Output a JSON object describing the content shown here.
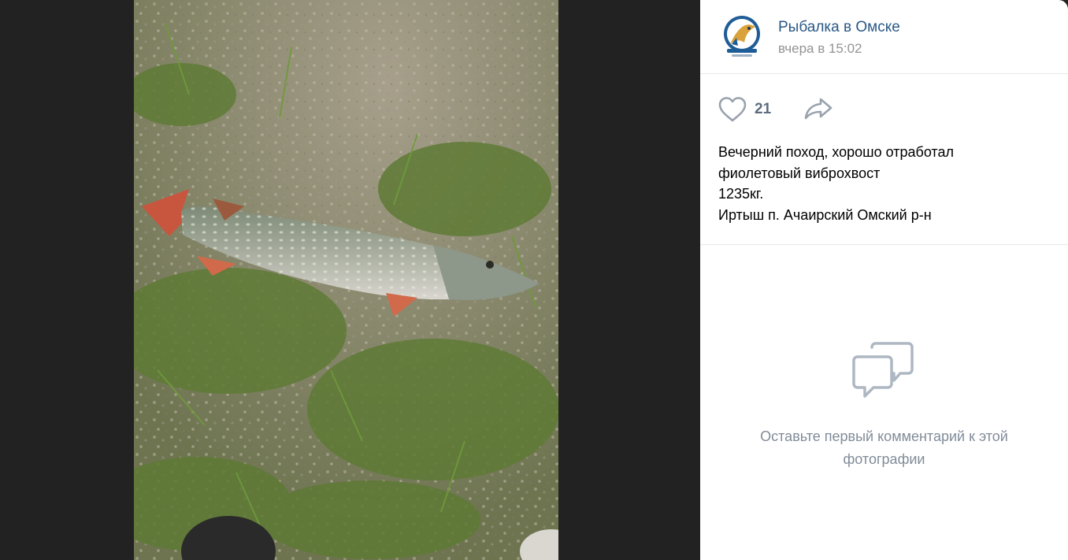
{
  "post": {
    "author": "Рыбалка в Омске",
    "time": "вчера в 15:02",
    "avatar_text": "РЫБАЛКА В ОМСКЕ",
    "likes": "21",
    "description": [
      "Вечерний поход, хорошо отработал",
      "фиолетовый виброхвост",
      "1235кг.",
      "Иртыш п. Ачаирский Омский р-н"
    ]
  },
  "comments": {
    "empty_text": "Оставьте первый комментарий к этой фотографии"
  },
  "icons": {
    "like": "heart-outline-icon",
    "share": "share-arrow-icon",
    "comments": "speech-bubbles-icon"
  },
  "colors": {
    "accent": "#2a5885",
    "muted": "#939393",
    "icon": "#99a2ad",
    "backdrop": "#222222"
  }
}
